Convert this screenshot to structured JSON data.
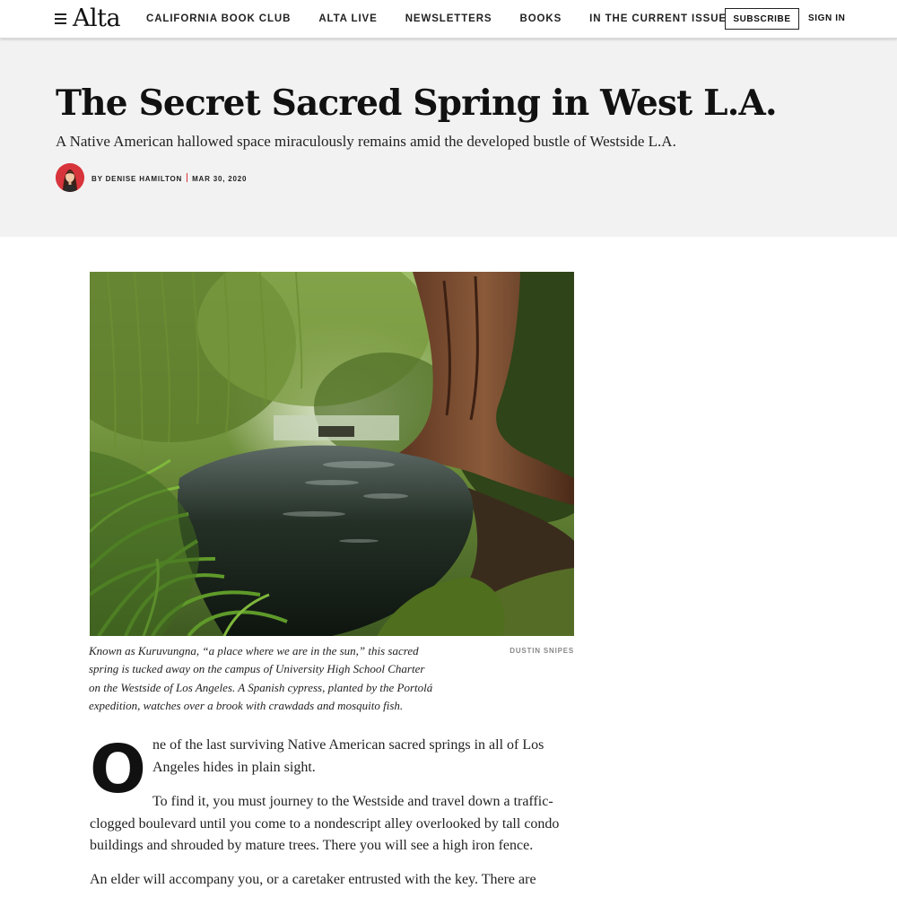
{
  "nav": {
    "logo": "Alta",
    "items": [
      {
        "label": "CALIFORNIA BOOK CLUB"
      },
      {
        "label": "ALTA LIVE"
      },
      {
        "label": "NEWSLETTERS"
      },
      {
        "label": "BOOKS"
      },
      {
        "label": "IN THE CURRENT ISSUE"
      }
    ],
    "subscribe_label": "SUBSCRIBE",
    "signin_label": "SIGN IN",
    "menu_icon": "hamburger-menu-icon"
  },
  "article": {
    "title": "The Secret Sacred Spring in West L.A.",
    "dek": "A Native American hallowed space miraculously remains amid the developed bustle of Westside L.A.",
    "byline_prefix": "BY",
    "author": "DENISE HAMILTON",
    "date": "MAR 30, 2020",
    "image": {
      "caption": "Known as Kuruvungna, “a place where we are in the sun,” this sacred spring is tucked away on the campus of University High School Charter on the Westside of Los Angeles. A Spanish cypress, planted by the Portolá expedition, watches over a brook with crawdads and mosquito fish.",
      "credit": "DUSTIN SNIPES"
    },
    "dropcap": "O",
    "paragraphs": [
      "ne of the last surviving Native American sacred springs in all of Los Angeles hides in plain sight.",
      "To find it, you must journey to the Westside and travel down a traffic-clogged boulevard until you come to a nondescript alley overlooked by tall condo buildings and shrouded by mature trees. There you will see a high iron fence.",
      "An elder will accompany you, or a caretaker entrusted with the key. There are"
    ]
  },
  "colors": {
    "accent": "#d8343b",
    "hero_background": "#f2f2f2",
    "text": "#111111"
  }
}
